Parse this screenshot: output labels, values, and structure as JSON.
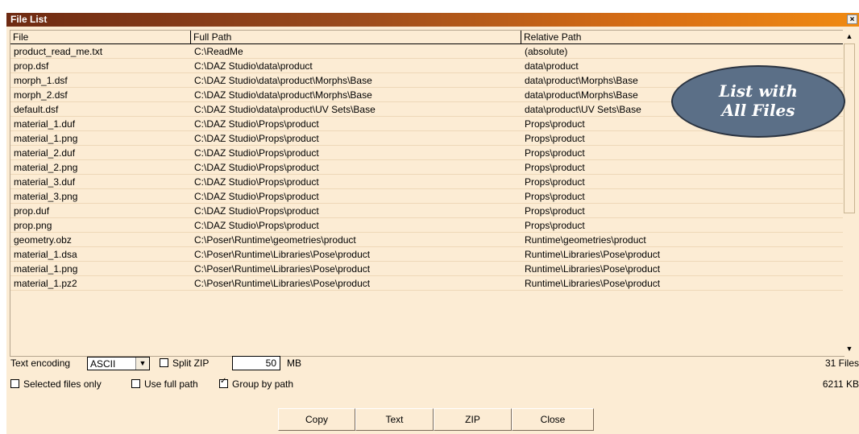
{
  "window": {
    "title": "File List",
    "close_label": "×"
  },
  "table": {
    "columns": [
      "File",
      "Full Path",
      "Relative Path"
    ],
    "rows": [
      [
        "product_read_me.txt",
        "C:\\ReadMe",
        "(absolute)"
      ],
      [
        "prop.dsf",
        "C:\\DAZ Studio\\data\\product",
        "data\\product"
      ],
      [
        "morph_1.dsf",
        "C:\\DAZ Studio\\data\\product\\Morphs\\Base",
        "data\\product\\Morphs\\Base"
      ],
      [
        "morph_2.dsf",
        "C:\\DAZ Studio\\data\\product\\Morphs\\Base",
        "data\\product\\Morphs\\Base"
      ],
      [
        "default.dsf",
        "C:\\DAZ Studio\\data\\product\\UV Sets\\Base",
        "data\\product\\UV Sets\\Base"
      ],
      [
        "material_1.duf",
        "C:\\DAZ Studio\\Props\\product",
        "Props\\product"
      ],
      [
        "material_1.png",
        "C:\\DAZ Studio\\Props\\product",
        "Props\\product"
      ],
      [
        "material_2.duf",
        "C:\\DAZ Studio\\Props\\product",
        "Props\\product"
      ],
      [
        "material_2.png",
        "C:\\DAZ Studio\\Props\\product",
        "Props\\product"
      ],
      [
        "material_3.duf",
        "C:\\DAZ Studio\\Props\\product",
        "Props\\product"
      ],
      [
        "material_3.png",
        "C:\\DAZ Studio\\Props\\product",
        "Props\\product"
      ],
      [
        "prop.duf",
        "C:\\DAZ Studio\\Props\\product",
        "Props\\product"
      ],
      [
        "prop.png",
        "C:\\DAZ Studio\\Props\\product",
        "Props\\product"
      ],
      [
        "geometry.obz",
        "C:\\Poser\\Runtime\\geometries\\product",
        "Runtime\\geometries\\product"
      ],
      [
        "material_1.dsa",
        "C:\\Poser\\Runtime\\Libraries\\Pose\\product",
        "Runtime\\Libraries\\Pose\\product"
      ],
      [
        "material_1.png",
        "C:\\Poser\\Runtime\\Libraries\\Pose\\product",
        "Runtime\\Libraries\\Pose\\product"
      ],
      [
        "material_1.pz2",
        "C:\\Poser\\Runtime\\Libraries\\Pose\\product",
        "Runtime\\Libraries\\Pose\\product"
      ]
    ]
  },
  "callout": {
    "line1": "List with",
    "line2": "All Files"
  },
  "options": {
    "encoding_label": "Text encoding",
    "encoding_value": "ASCII",
    "split_zip_label": "Split ZIP",
    "split_zip_checked": false,
    "split_size": "50",
    "split_unit": "MB",
    "selected_only_label": "Selected files only",
    "selected_only_checked": false,
    "full_path_label": "Use full path",
    "full_path_checked": false,
    "group_label": "Group by path",
    "group_checked": true
  },
  "summary": {
    "files": "31 Files",
    "size": "6211 KB"
  },
  "buttons": {
    "copy": "Copy",
    "text": "Text",
    "zip": "ZIP",
    "close": "Close"
  },
  "colors": {
    "background": "#fcecd4",
    "title_start": "#6e2a12",
    "title_end": "#f08a12",
    "callout": "#5b6f87"
  }
}
